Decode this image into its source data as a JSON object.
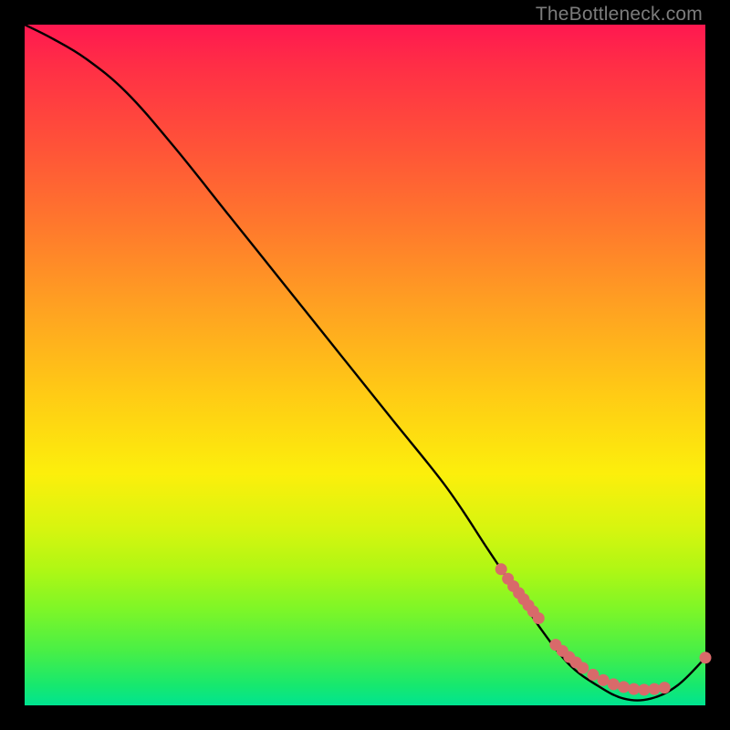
{
  "watermark": "TheBottleneck.com",
  "chart_data": {
    "type": "line",
    "title": "",
    "xlabel": "",
    "ylabel": "",
    "xlim": [
      0,
      100
    ],
    "ylim": [
      0,
      100
    ],
    "grid": false,
    "legend": false,
    "series": [
      {
        "name": "curve",
        "color": "#000000",
        "x": [
          0,
          4,
          9,
          15,
          22,
          30,
          38,
          46,
          54,
          62,
          68,
          72,
          76,
          80,
          84,
          88,
          92,
          96,
          100
        ],
        "y": [
          100,
          98,
          95,
          90,
          82,
          72,
          62,
          52,
          42,
          32,
          23,
          17,
          11,
          6,
          3,
          1,
          1,
          3,
          7
        ]
      }
    ],
    "point_clusters": [
      {
        "name": "upper-cluster",
        "color": "#d86a6a",
        "radius": 6.5,
        "x": [
          70.0,
          71.0,
          71.8,
          72.6,
          73.3,
          74.0,
          74.7,
          75.5
        ],
        "y": [
          20.0,
          18.6,
          17.5,
          16.5,
          15.6,
          14.7,
          13.8,
          12.8
        ]
      },
      {
        "name": "lower-cluster",
        "color": "#d86a6a",
        "radius": 6.5,
        "x": [
          78.0,
          79.0,
          80.0,
          81.0,
          82.0,
          83.5,
          85.0,
          86.5,
          88.0,
          89.5,
          91.0,
          92.5,
          94.0
        ],
        "y": [
          8.9,
          8.0,
          7.1,
          6.3,
          5.5,
          4.5,
          3.7,
          3.1,
          2.7,
          2.4,
          2.3,
          2.4,
          2.6
        ]
      },
      {
        "name": "endpoint",
        "color": "#d86a6a",
        "radius": 6.5,
        "x": [
          100.0
        ],
        "y": [
          7.0
        ]
      }
    ]
  }
}
